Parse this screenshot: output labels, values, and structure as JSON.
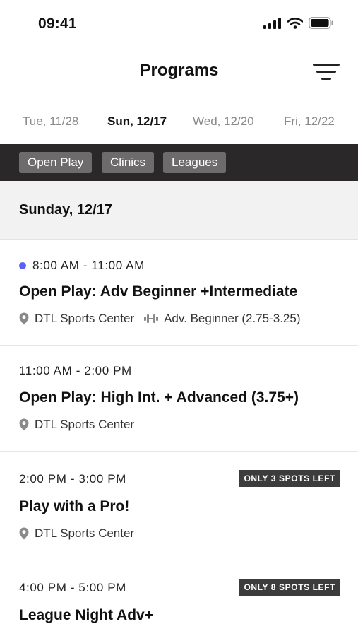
{
  "status_bar": {
    "time": "09:41"
  },
  "nav": {
    "title": "Programs",
    "filter_icon": "filter-lines-icon"
  },
  "dates": [
    "Tue, 11/28",
    "Sun, 12/17",
    "Wed, 12/20",
    "Fri, 12/22"
  ],
  "selected_date": "Sun, 12/17",
  "chips": [
    "Open Play",
    "Clinics",
    "Leagues"
  ],
  "section": {
    "title": "Sunday, 12/17"
  },
  "programs": [
    {
      "time": "8:00 AM - 11:00 AM",
      "title": "Open Play: Adv Beginner +Intermediate",
      "location": "DTL Sports Center",
      "level": "Adv. Beginner (2.75-3.25)"
    },
    {
      "time": "11:00 AM - 2:00 PM",
      "title": "Open Play: High Int. + Advanced (3.75+)",
      "location": "DTL Sports Center"
    },
    {
      "time": "2:00 PM - 3:00 PM",
      "title": "Play with a Pro!",
      "location": "DTL Sports Center",
      "badge": "ONLY 3 SPOTS LEFT"
    },
    {
      "time": "4:00 PM - 5:00 PM",
      "title": "League Night Adv+",
      "badge": "ONLY 8 SPOTS LEFT"
    }
  ],
  "colors": {
    "chip_bar_bg": "#2b2829",
    "chip_bg": "#6e6b6c",
    "dot": "#5a63f0",
    "badge_bg": "#3c3c3c"
  }
}
